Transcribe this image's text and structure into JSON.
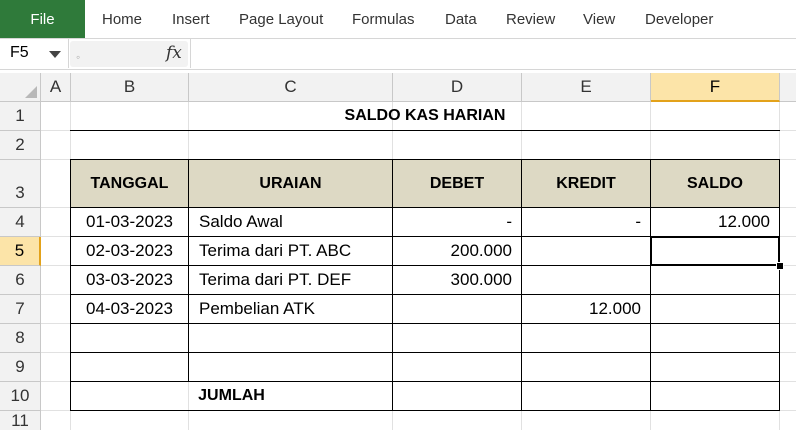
{
  "ribbon": {
    "file_label": "File",
    "tabs": [
      "Home",
      "Insert",
      "Page Layout",
      "Formulas",
      "Data",
      "Review",
      "View",
      "Developer"
    ]
  },
  "formula_bar": {
    "name_box": "F5",
    "fx_label": "fx",
    "formula": ""
  },
  "grid": {
    "columns": [
      "A",
      "B",
      "C",
      "D",
      "E",
      "F"
    ],
    "rows": [
      "1",
      "2",
      "3",
      "4",
      "5",
      "6",
      "7",
      "8",
      "9",
      "10",
      "11"
    ],
    "selected_cell": "F5"
  },
  "sheet": {
    "title": "SALDO KAS HARIAN",
    "headers": [
      "TANGGAL",
      "URAIAN",
      "DEBET",
      "KREDIT",
      "SALDO"
    ],
    "rows": [
      {
        "tanggal": "01-03-2023",
        "uraian": "Saldo Awal",
        "debet": "-",
        "kredit": "-",
        "saldo": "12.000"
      },
      {
        "tanggal": "02-03-2023",
        "uraian": "Terima dari PT. ABC",
        "debet": "200.000",
        "kredit": "",
        "saldo": ""
      },
      {
        "tanggal": "03-03-2023",
        "uraian": "Terima dari PT. DEF",
        "debet": "300.000",
        "kredit": "",
        "saldo": ""
      },
      {
        "tanggal": "04-03-2023",
        "uraian": "Pembelian ATK",
        "debet": "",
        "kredit": "12.000",
        "saldo": ""
      },
      {
        "tanggal": "",
        "uraian": "",
        "debet": "",
        "kredit": "",
        "saldo": ""
      },
      {
        "tanggal": "",
        "uraian": "",
        "debet": "",
        "kredit": "",
        "saldo": ""
      }
    ],
    "total_label": "JUMLAH"
  },
  "colors": {
    "file_tab": "#2f7a3a",
    "header_fill": "#ddd9c4",
    "selected_header": "#fce4a8"
  }
}
